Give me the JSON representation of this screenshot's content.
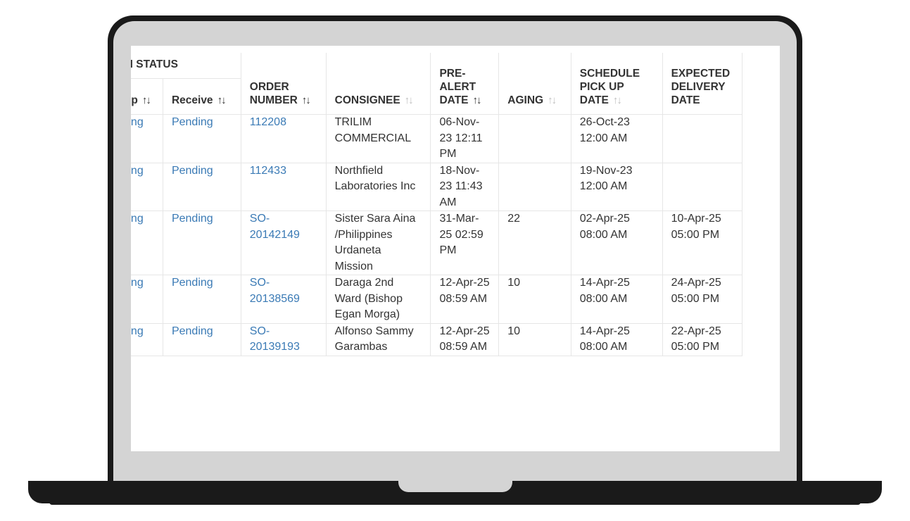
{
  "table": {
    "group_header": "SCAN STATUS",
    "columns": {
      "pickup": "Pickup",
      "receive": "Receive",
      "order_number": "ORDER NUMBER",
      "consignee": "CONSIGNEE",
      "pre_alert_date": "PRE-ALERT DATE",
      "aging": "AGING",
      "schedule_pickup_date": "SCHEDULE PICK UP DATE",
      "expected_delivery_date": "EXPECTED DELIVERY DATE"
    },
    "sort_icon": "sort-arrows-icon",
    "rows": [
      {
        "pickup": "Pending",
        "receive": "Pending",
        "order_number": "112208",
        "consignee": "TRILIM COMMERCIAL",
        "pre_alert_date": "06-Nov-23 12:11 PM",
        "aging": "",
        "schedule_pickup_date": "26-Oct-23 12:00 AM",
        "expected_delivery_date": ""
      },
      {
        "pickup": "Pending",
        "receive": "Pending",
        "order_number": "112433",
        "consignee": "Northfield Laboratories Inc",
        "pre_alert_date": "18-Nov-23 11:43 AM",
        "aging": "",
        "schedule_pickup_date": "19-Nov-23 12:00 AM",
        "expected_delivery_date": ""
      },
      {
        "pickup": "Pending",
        "receive": "Pending",
        "order_number": "SO-20142149",
        "consignee": "Sister Sara Aina /Philippines Urdaneta Mission",
        "pre_alert_date": "31-Mar-25 02:59 PM",
        "aging": "22",
        "schedule_pickup_date": "02-Apr-25 08:00 AM",
        "expected_delivery_date": "10-Apr-25 05:00 PM"
      },
      {
        "pickup": "Pending",
        "receive": "Pending",
        "order_number": "SO-20138569",
        "consignee": "Daraga 2nd Ward (Bishop Egan Morga)",
        "pre_alert_date": "12-Apr-25 08:59 AM",
        "aging": "10",
        "schedule_pickup_date": "14-Apr-25 08:00 AM",
        "expected_delivery_date": "24-Apr-25 05:00 PM"
      },
      {
        "pickup": "Pending",
        "receive": "Pending",
        "order_number": "SO-20139193",
        "consignee": "Alfonso Sammy Garambas",
        "pre_alert_date": "12-Apr-25 08:59 AM",
        "aging": "10",
        "schedule_pickup_date": "14-Apr-25 08:00 AM",
        "expected_delivery_date": "22-Apr-25 05:00 PM"
      }
    ]
  },
  "colors": {
    "link": "#3a7ab5",
    "text": "#333333",
    "border": "#e6e6e6",
    "frame": "#1a1a1a",
    "bezel": "#d4d4d4"
  }
}
